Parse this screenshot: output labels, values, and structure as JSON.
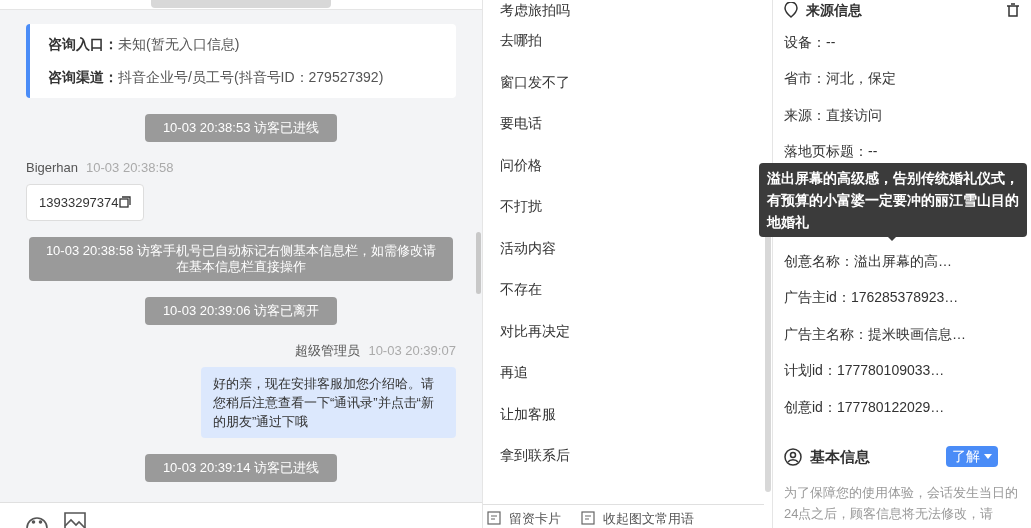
{
  "chat": {
    "entry_card": [
      {
        "label": "咨询入口：",
        "value": "未知(暂无入口信息)"
      },
      {
        "label": "咨询渠道：",
        "value": "抖音企业号/员工号(抖音号ID：279527392)"
      }
    ],
    "messages": [
      {
        "kind": "notice",
        "text": "10-03 20:38:53 访客已进线"
      },
      {
        "kind": "visitor",
        "sender": "Bigerhan",
        "time": "10-03 20:38:58",
        "text": "13933297374"
      },
      {
        "kind": "notice",
        "text": "10-03 20:38:58 访客手机号已自动标记右侧基本信息栏，如需修改请在基本信息栏直接操作"
      },
      {
        "kind": "notice",
        "text": "10-03 20:39:06 访客已离开"
      },
      {
        "kind": "agent",
        "sender": "超级管理员",
        "time": "10-03 20:39:07",
        "text": "好的亲，现在安排客服加您介绍哈。请您稍后注意查看一下“通讯录”并点击“新的朋友”通过下哦"
      },
      {
        "kind": "notice",
        "text": "10-03 20:39:14 访客已进线"
      }
    ]
  },
  "quick_replies": {
    "items": [
      "考虑旅拍吗",
      "去哪拍",
      "窗口发不了",
      "要电话",
      "问价格",
      "不打扰",
      "活动内容",
      "不存在",
      "对比再决定",
      "再追",
      "让加客服",
      "拿到联系后"
    ],
    "footer": [
      "留资卡片",
      "收起图文常用语"
    ]
  },
  "source_info": {
    "title": "来源信息",
    "rows": [
      "设备：--",
      "省市：河北，保定",
      "来源：直接访问",
      "落地页标题：--",
      "创意名称：溢出屏幕的高…",
      "广告主id：176285378923…",
      "广告主名称：提米映画信息…",
      "计划id：177780109033…",
      "创意id：177780122029…"
    ],
    "tooltip": "溢出屏幕的高级感，告别传统婚礼仪式，有预算的小富婆一定要冲的丽江雪山目的地婚礼"
  },
  "basic_info": {
    "title": "基本信息",
    "button": "了解",
    "note": "为了保障您的使用体验，会话发生当日的24点之后，顾客信息将无法修改，请"
  }
}
